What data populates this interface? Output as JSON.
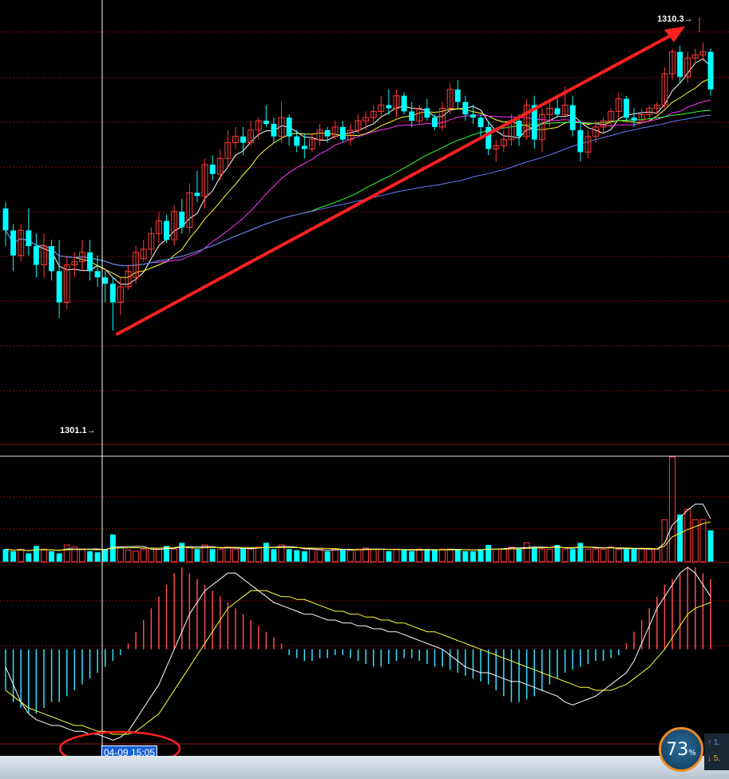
{
  "chart_data": {
    "type": "candlestick",
    "title": "",
    "price_annotations": {
      "high_label": "1310.3→",
      "low_label": "1301.1→",
      "high_value": 1310.3,
      "low_value": 1301.1
    },
    "crosshair": {
      "time_label": "04-09 15:05"
    },
    "price_range": [
      1297.5,
      1311.4
    ],
    "volume_range": [
      0,
      100
    ],
    "macd_range": [
      -32,
      28
    ],
    "candles": [
      [
        1305.0,
        1305.2,
        1303.8,
        1304.3
      ],
      [
        1304.3,
        1304.5,
        1303.0,
        1303.5
      ],
      [
        1303.5,
        1304.5,
        1303.3,
        1304.3
      ],
      [
        1304.3,
        1305.0,
        1303.5,
        1303.8
      ],
      [
        1303.8,
        1304.2,
        1302.8,
        1303.2
      ],
      [
        1303.2,
        1304.2,
        1302.8,
        1303.8
      ],
      [
        1303.8,
        1304.0,
        1302.7,
        1303.0
      ],
      [
        1303.0,
        1304.0,
        1301.5,
        1302.0
      ],
      [
        1302.0,
        1303.5,
        1301.8,
        1303.2
      ],
      [
        1303.2,
        1303.6,
        1302.8,
        1303.3
      ],
      [
        1303.3,
        1304.0,
        1303.0,
        1303.6
      ],
      [
        1303.6,
        1304.0,
        1302.7,
        1303.0
      ],
      [
        1303.0,
        1303.5,
        1302.5,
        1302.8
      ],
      [
        1302.8,
        1303.0,
        1302.0,
        1302.6
      ],
      [
        1302.6,
        1302.8,
        1301.1,
        1302.0
      ],
      [
        1302.0,
        1302.8,
        1301.6,
        1302.5
      ],
      [
        1302.5,
        1303.2,
        1302.4,
        1303.0
      ],
      [
        1302.8,
        1303.8,
        1302.6,
        1303.6
      ],
      [
        1303.4,
        1304.0,
        1303.3,
        1303.7
      ],
      [
        1303.7,
        1304.4,
        1303.5,
        1304.2
      ],
      [
        1304.2,
        1304.9,
        1303.9,
        1304.6
      ],
      [
        1304.6,
        1304.8,
        1303.9,
        1304.0
      ],
      [
        1304.0,
        1305.1,
        1303.8,
        1304.9
      ],
      [
        1304.9,
        1305.3,
        1304.2,
        1304.4
      ],
      [
        1304.4,
        1305.8,
        1304.2,
        1305.5
      ],
      [
        1305.5,
        1306.2,
        1305.2,
        1305.4
      ],
      [
        1305.4,
        1306.6,
        1305.0,
        1306.4
      ],
      [
        1306.4,
        1306.7,
        1305.9,
        1306.1
      ],
      [
        1306.1,
        1306.9,
        1305.9,
        1306.6
      ],
      [
        1306.6,
        1307.5,
        1306.3,
        1307.1
      ],
      [
        1307.1,
        1307.6,
        1306.9,
        1307.3
      ],
      [
        1307.3,
        1307.6,
        1306.7,
        1307.1
      ],
      [
        1307.1,
        1307.8,
        1307.0,
        1307.5
      ],
      [
        1307.5,
        1307.9,
        1307.2,
        1307.8
      ],
      [
        1307.8,
        1308.3,
        1307.6,
        1307.7
      ],
      [
        1307.7,
        1307.9,
        1307.1,
        1307.3
      ],
      [
        1307.3,
        1308.4,
        1307.1,
        1307.9
      ],
      [
        1307.9,
        1308.0,
        1307.0,
        1307.3
      ],
      [
        1307.3,
        1307.5,
        1306.8,
        1307.0
      ],
      [
        1307.0,
        1307.4,
        1306.6,
        1306.9
      ],
      [
        1306.9,
        1307.4,
        1306.8,
        1307.2
      ],
      [
        1307.2,
        1307.7,
        1307.0,
        1307.5
      ],
      [
        1307.5,
        1307.6,
        1307.1,
        1307.3
      ],
      [
        1307.3,
        1307.8,
        1307.2,
        1307.6
      ],
      [
        1307.6,
        1307.8,
        1307.1,
        1307.2
      ],
      [
        1307.2,
        1307.7,
        1307.0,
        1307.5
      ],
      [
        1307.5,
        1308.0,
        1307.4,
        1307.8
      ],
      [
        1307.8,
        1308.1,
        1307.5,
        1307.9
      ],
      [
        1307.9,
        1308.3,
        1307.7,
        1308.1
      ],
      [
        1308.1,
        1308.6,
        1307.9,
        1308.3
      ],
      [
        1308.3,
        1308.8,
        1308.0,
        1308.2
      ],
      [
        1308.2,
        1308.8,
        1307.9,
        1308.6
      ],
      [
        1308.6,
        1308.7,
        1308.0,
        1308.1
      ],
      [
        1308.1,
        1308.4,
        1307.6,
        1307.8
      ],
      [
        1307.8,
        1308.3,
        1307.7,
        1308.2
      ],
      [
        1308.2,
        1308.5,
        1307.8,
        1307.9
      ],
      [
        1307.9,
        1308.0,
        1307.5,
        1307.6
      ],
      [
        1307.6,
        1308.4,
        1307.5,
        1308.2
      ],
      [
        1308.2,
        1309.0,
        1308.0,
        1308.8
      ],
      [
        1308.8,
        1309.1,
        1308.2,
        1308.4
      ],
      [
        1308.4,
        1308.6,
        1307.8,
        1308.0
      ],
      [
        1308.0,
        1308.3,
        1307.7,
        1307.9
      ],
      [
        1307.9,
        1308.0,
        1307.3,
        1307.6
      ],
      [
        1307.6,
        1307.8,
        1306.7,
        1306.9
      ],
      [
        1306.9,
        1307.2,
        1306.5,
        1307.0
      ],
      [
        1307.0,
        1307.5,
        1306.8,
        1307.2
      ],
      [
        1307.2,
        1308.0,
        1307.0,
        1307.8
      ],
      [
        1307.8,
        1308.0,
        1307.0,
        1307.3
      ],
      [
        1307.3,
        1308.5,
        1307.2,
        1308.3
      ],
      [
        1308.3,
        1308.6,
        1306.9,
        1307.2
      ],
      [
        1307.2,
        1308.2,
        1306.8,
        1308.0
      ],
      [
        1308.0,
        1308.5,
        1307.6,
        1308.2
      ],
      [
        1308.2,
        1308.5,
        1307.9,
        1308.0
      ],
      [
        1308.0,
        1308.9,
        1307.9,
        1308.3
      ],
      [
        1308.3,
        1308.6,
        1307.3,
        1307.5
      ],
      [
        1307.5,
        1307.8,
        1306.5,
        1306.8
      ],
      [
        1306.8,
        1307.5,
        1306.6,
        1307.3
      ],
      [
        1307.3,
        1307.8,
        1307.1,
        1307.6
      ],
      [
        1307.6,
        1307.9,
        1307.4,
        1307.8
      ],
      [
        1307.8,
        1308.2,
        1307.6,
        1308.1
      ],
      [
        1308.1,
        1308.7,
        1307.9,
        1308.5
      ],
      [
        1308.5,
        1308.6,
        1307.8,
        1307.9
      ],
      [
        1307.9,
        1308.2,
        1307.6,
        1307.8
      ],
      [
        1307.8,
        1308.2,
        1307.7,
        1308.0
      ],
      [
        1308.0,
        1308.3,
        1307.8,
        1308.2
      ],
      [
        1308.2,
        1308.4,
        1308.0,
        1308.3
      ],
      [
        1308.3,
        1309.5,
        1308.2,
        1309.3
      ],
      [
        1309.3,
        1310.1,
        1309.1,
        1310.0
      ],
      [
        1310.0,
        1310.2,
        1309.0,
        1309.2
      ],
      [
        1309.2,
        1310.0,
        1309.0,
        1309.8
      ],
      [
        1309.8,
        1310.1,
        1309.6,
        1309.9
      ],
      [
        1309.9,
        1310.3,
        1309.7,
        1310.0
      ],
      [
        1310.0,
        1310.1,
        1308.6,
        1308.8
      ]
    ],
    "ma_colors": [
      "#ffffff",
      "#ffff33",
      "#ff33ff",
      "#33ff33",
      "#6a78ff"
    ],
    "ma_periods": [
      5,
      10,
      20,
      40,
      60
    ],
    "up_color": "#ff3b3b",
    "down_color": "#00ffff",
    "volume": [
      12,
      10,
      12,
      8,
      15,
      12,
      10,
      8,
      16,
      14,
      12,
      10,
      9,
      12,
      26,
      14,
      11,
      10,
      12,
      13,
      12,
      15,
      12,
      18,
      14,
      12,
      16,
      12,
      12,
      14,
      12,
      13,
      12,
      14,
      18,
      12,
      16,
      12,
      11,
      10,
      12,
      12,
      10,
      12,
      12,
      11,
      12,
      13,
      12,
      12,
      10,
      12,
      11,
      10,
      12,
      12,
      11,
      12,
      12,
      12,
      10,
      10,
      12,
      16,
      12,
      12,
      14,
      12,
      18,
      14,
      12,
      12,
      16,
      12,
      12,
      18,
      12,
      12,
      12,
      14,
      12,
      12,
      12,
      12,
      12,
      12,
      40,
      100,
      45,
      50,
      40,
      40,
      30
    ],
    "macd_hist": [
      -14,
      -18,
      -20,
      -22,
      -22,
      -20,
      -18,
      -18,
      -16,
      -14,
      -12,
      -10,
      -8,
      -6,
      -4,
      -2,
      2,
      6,
      10,
      14,
      18,
      22,
      26,
      28,
      26,
      24,
      22,
      20,
      18,
      16,
      14,
      12,
      10,
      8,
      6,
      4,
      2,
      -2,
      -3,
      -4,
      -4,
      -3,
      -3,
      -2,
      -2,
      -3,
      -4,
      -5,
      -6,
      -6,
      -5,
      -4,
      -3,
      -3,
      -4,
      -5,
      -6,
      -6,
      -7,
      -8,
      -9,
      -10,
      -11,
      -12,
      -14,
      -16,
      -18,
      -18,
      -17,
      -16,
      -14,
      -12,
      -10,
      -8,
      -7,
      -6,
      -5,
      -4,
      -4,
      -3,
      -2,
      2,
      6,
      10,
      14,
      18,
      22,
      24,
      26,
      28,
      28,
      26,
      24
    ],
    "macd_dif": [
      -6,
      -12,
      -18,
      -22,
      -24,
      -25,
      -26,
      -26,
      -27,
      -28,
      -28,
      -29,
      -29,
      -30,
      -31,
      -30,
      -28,
      -24,
      -20,
      -16,
      -12,
      -6,
      0,
      6,
      12,
      16,
      20,
      22,
      24,
      26,
      26,
      24,
      22,
      20,
      18,
      16,
      15,
      14,
      13,
      12,
      12,
      11,
      10,
      10,
      9,
      9,
      8,
      8,
      7,
      7,
      6,
      6,
      5,
      4,
      3,
      2,
      1,
      0,
      -2,
      -4,
      -6,
      -7,
      -8,
      -8,
      -9,
      -10,
      -11,
      -11,
      -12,
      -13,
      -14,
      -15,
      -16,
      -18,
      -19,
      -18,
      -17,
      -16,
      -14,
      -12,
      -10,
      -8,
      -4,
      2,
      8,
      14,
      18,
      22,
      26,
      28,
      26,
      22,
      18
    ],
    "macd_dea": [
      -14,
      -16,
      -18,
      -20,
      -21,
      -22,
      -23,
      -24,
      -25,
      -26,
      -26,
      -27,
      -28,
      -28,
      -29,
      -29,
      -29,
      -28,
      -26,
      -24,
      -22,
      -18,
      -14,
      -10,
      -6,
      -2,
      2,
      6,
      10,
      14,
      16,
      18,
      20,
      20,
      20,
      19,
      18,
      18,
      17,
      17,
      16,
      15,
      14,
      13,
      13,
      12,
      12,
      11,
      11,
      10,
      10,
      9,
      9,
      8,
      7,
      6,
      6,
      5,
      4,
      3,
      2,
      1,
      0,
      -1,
      -2,
      -3,
      -4,
      -5,
      -6,
      -7,
      -8,
      -9,
      -10,
      -11,
      -12,
      -13,
      -13,
      -14,
      -14,
      -14,
      -13,
      -12,
      -10,
      -8,
      -6,
      -3,
      0,
      4,
      8,
      12,
      14,
      15,
      16
    ]
  },
  "status": {
    "gauge_value": "73",
    "gauge_unit": "%",
    "side_row1": "↑ 1.",
    "side_row2": "↓ 5."
  }
}
